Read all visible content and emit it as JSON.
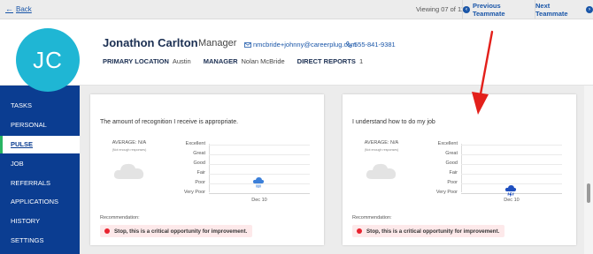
{
  "topbar": {
    "back_label": "Back",
    "viewing": "Viewing 07 of 11",
    "prev_label": "Previous Teammate",
    "next_label": "Next Teammate"
  },
  "profile": {
    "initials": "JC",
    "name": "Jonathon Carlton",
    "role": "Manager",
    "email": "nmcbride+johnny@careerplug.com",
    "phone": "555-841-9381",
    "primary_location_label": "PRIMARY LOCATION",
    "primary_location": "Austin",
    "manager_label": "MANAGER",
    "manager": "Nolan McBride",
    "direct_reports_label": "DIRECT REPORTS",
    "direct_reports": "1"
  },
  "sidebar": {
    "items": [
      {
        "label": "TASKS"
      },
      {
        "label": "PERSONAL"
      },
      {
        "label": "PULSE",
        "active": true
      },
      {
        "label": "JOB"
      },
      {
        "label": "REFERRALS"
      },
      {
        "label": "APPLICATIONS"
      },
      {
        "label": "HISTORY"
      },
      {
        "label": "SETTINGS"
      }
    ]
  },
  "cards": [
    {
      "question": "The amount of recognition I receive is appropriate.",
      "average": "AVERAGE: N/A",
      "average_note": "(Not enough responses)",
      "y_labels": [
        "Excellent",
        "Great",
        "Good",
        "Fair",
        "Poor",
        "Very Poor"
      ],
      "x_label": "Dec 10",
      "value": "Poor",
      "recommendation_label": "Recommendation:",
      "recommendation": "Stop, this is a critical opportunity for improvement."
    },
    {
      "question": "I understand how to do my job",
      "average": "AVERAGE: N/A",
      "average_note": "(Not enough responses)",
      "y_labels": [
        "Excellent",
        "Great",
        "Good",
        "Fair",
        "Poor",
        "Very Poor"
      ],
      "x_label": "Dec 10",
      "value": "Very Poor",
      "recommendation_label": "Recommendation:",
      "recommendation": "Stop, this is a critical opportunity for improvement."
    }
  ],
  "colors": {
    "nav_bg": "#0b3d91",
    "avatar": "#1fb6d4",
    "link": "#1a56a8",
    "critical": "#e8232f",
    "active_marker": "#28b463",
    "annotation_arrow": "#e3201b"
  },
  "icons": [
    "back-arrow-icon",
    "chevron-left-icon",
    "chevron-right-icon",
    "envelope-icon",
    "phone-icon",
    "cloud-icon",
    "rain-cloud-icon",
    "storm-cloud-icon"
  ]
}
